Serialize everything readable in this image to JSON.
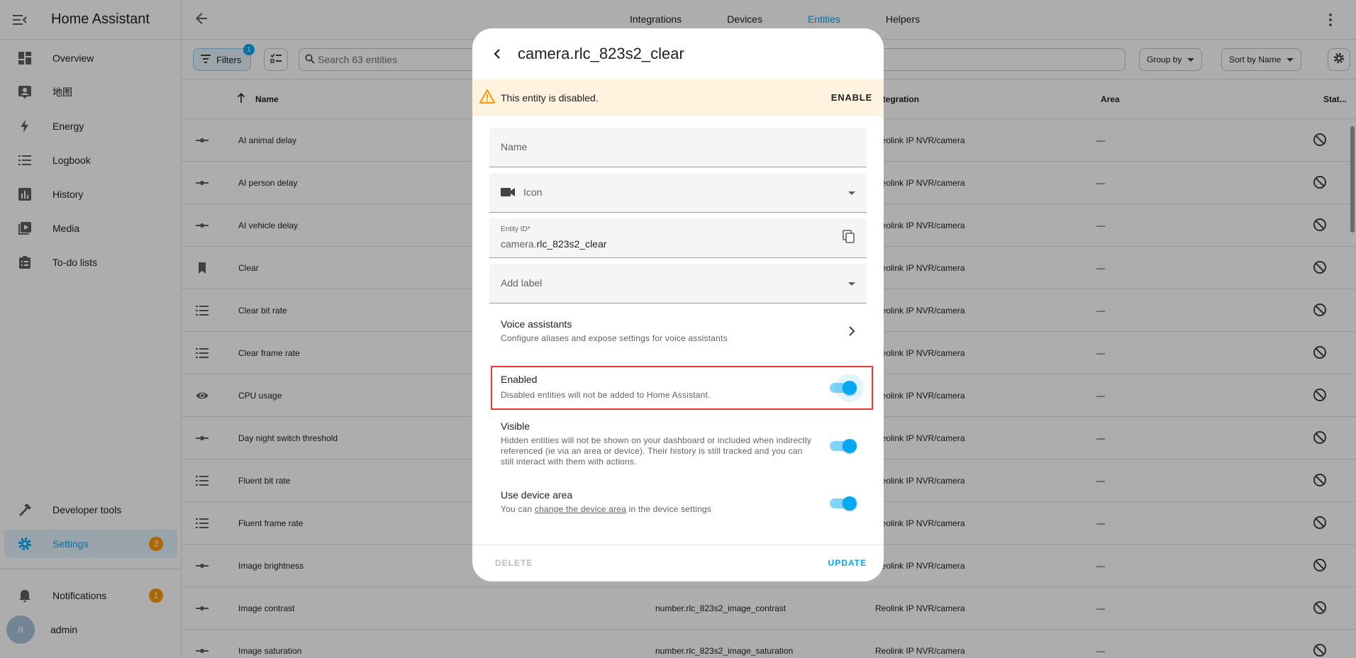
{
  "app_title": "Home Assistant",
  "sidebar": {
    "items": [
      {
        "label": "Overview",
        "icon": "dashboard-icon"
      },
      {
        "label": "地图",
        "icon": "map-account-icon"
      },
      {
        "label": "Energy",
        "icon": "lightning-icon"
      },
      {
        "label": "Logbook",
        "icon": "list-icon"
      },
      {
        "label": "History",
        "icon": "chart-box-icon"
      },
      {
        "label": "Media",
        "icon": "play-box-icon"
      },
      {
        "label": "To-do lists",
        "icon": "clipboard-list-icon"
      }
    ],
    "developer_tools": "Developer tools",
    "settings": {
      "label": "Settings",
      "badge": "3"
    },
    "notifications": {
      "label": "Notifications",
      "badge": "1"
    },
    "user": {
      "name": "admin",
      "initial": "a"
    }
  },
  "topbar": {
    "tabs": [
      "Integrations",
      "Devices",
      "Entities",
      "Helpers"
    ],
    "active_tab": "Entities"
  },
  "toolbar": {
    "filters_label": "Filters",
    "filters_count": "1",
    "search_placeholder": "Search 63 entities",
    "group_by": "Group by",
    "sort_by": "Sort by Name"
  },
  "table": {
    "headers": {
      "name": "Name",
      "integration": "Integration",
      "area": "Area",
      "status": "Stat..."
    },
    "rows": [
      {
        "name": "AI animal delay",
        "entity_id": "",
        "integration": "Reolink IP NVR/camera",
        "area": "—",
        "icon": "slider-icon"
      },
      {
        "name": "AI person delay",
        "entity_id": "",
        "integration": "Reolink IP NVR/camera",
        "area": "—",
        "icon": "slider-icon"
      },
      {
        "name": "AI vehicle delay",
        "entity_id": "",
        "integration": "Reolink IP NVR/camera",
        "area": "—",
        "icon": "slider-icon"
      },
      {
        "name": "Clear",
        "entity_id": "",
        "integration": "Reolink IP NVR/camera",
        "area": "—",
        "icon": "bookmark-icon"
      },
      {
        "name": "Clear bit rate",
        "entity_id": "",
        "integration": "Reolink IP NVR/camera",
        "area": "—",
        "icon": "list-icon"
      },
      {
        "name": "Clear frame rate",
        "entity_id": "",
        "integration": "Reolink IP NVR/camera",
        "area": "—",
        "icon": "list-icon"
      },
      {
        "name": "CPU usage",
        "entity_id": "",
        "integration": "Reolink IP NVR/camera",
        "area": "—",
        "icon": "eye-icon"
      },
      {
        "name": "Day night switch threshold",
        "entity_id": "",
        "integration": "Reolink IP NVR/camera",
        "area": "—",
        "icon": "slider-icon"
      },
      {
        "name": "Fluent bit rate",
        "entity_id": "",
        "integration": "Reolink IP NVR/camera",
        "area": "—",
        "icon": "list-icon"
      },
      {
        "name": "Fluent frame rate",
        "entity_id": "",
        "integration": "Reolink IP NVR/camera",
        "area": "—",
        "icon": "list-icon"
      },
      {
        "name": "Image brightness",
        "entity_id": "",
        "integration": "Reolink IP NVR/camera",
        "area": "—",
        "icon": "slider-icon"
      },
      {
        "name": "Image contrast",
        "entity_id": "number.rlc_823s2_image_contrast",
        "integration": "Reolink IP NVR/camera",
        "area": "—",
        "icon": "slider-icon"
      },
      {
        "name": "Image saturation",
        "entity_id": "number.rlc_823s2_image_saturation",
        "integration": "Reolink IP NVR/camera",
        "area": "—",
        "icon": "slider-icon"
      }
    ]
  },
  "dialog": {
    "title": "camera.rlc_823s2_clear",
    "warning_text": "This entity is disabled.",
    "enable_label": "ENABLE",
    "name_placeholder": "Name",
    "icon_label": "Icon",
    "entity_id_label": "Entity ID*",
    "entity_id_prefix": "camera.",
    "entity_id_value": "rlc_823s2_clear",
    "add_label_placeholder": "Add label",
    "voice_title": "Voice assistants",
    "voice_desc": "Configure aliases and expose settings for voice assistants",
    "enabled_title": "Enabled",
    "enabled_desc": "Disabled entities will not be added to Home Assistant.",
    "visible_title": "Visible",
    "visible_desc": "Hidden entities will not be shown on your dashboard or included when indirectly referenced (ie via an area or device). Their history is still tracked and you can still interact with them with actions.",
    "device_area_title": "Use device area",
    "device_area_desc_pre": "You can ",
    "device_area_link": "change the device area",
    "device_area_desc_post": " in the device settings",
    "delete_label": "DELETE",
    "update_label": "UPDATE"
  },
  "colors": {
    "accent": "#03a9f4",
    "badge": "#ff9800",
    "warning_bg": "#fff3e0",
    "highlight": "#e53935"
  }
}
